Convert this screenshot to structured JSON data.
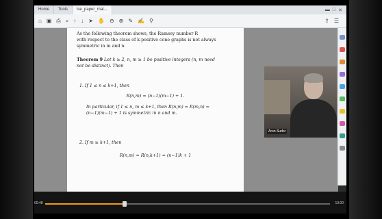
{
  "tabs": [
    "Home",
    "Tools",
    "lse_paper_mat..."
  ],
  "toolbar_icons": [
    "save-icon",
    "print-icon",
    "undo-icon",
    "zoom-icon"
  ],
  "doc": {
    "intro": [
      "As the following theorem shows, the Ramsey number R",
      "with respect to the class of k-positive cone graphs is not always",
      "symmetric in m and n."
    ],
    "theorem_label": "Theorem 9",
    "theorem_text": [
      "Let k ≥ 2, n, m ≥ 1 be positive integers (n, m need",
      "not be distinct). Then"
    ],
    "item1": "1. If 1 ≤ n ≤ k+1, then",
    "formula1": "R(n,m) = (n−1)(m−1) + 1.",
    "item1_cont": [
      "In particular, if 1 ≤ n, m ≤ k+1, then R(n,m) = R(m,n) =",
      "(n−1)(m−1) + 1 is symmetric in n and m."
    ],
    "item2": "2. If m ≥ k+1, then",
    "formula2": "R(n,m) = R(n,k+1) = (n−1)k + 1"
  },
  "webcam": {
    "name": "Aron Sudor"
  },
  "player": {
    "time_elapsed": "00:48",
    "time_total": "13:00",
    "progress": 0.28
  }
}
